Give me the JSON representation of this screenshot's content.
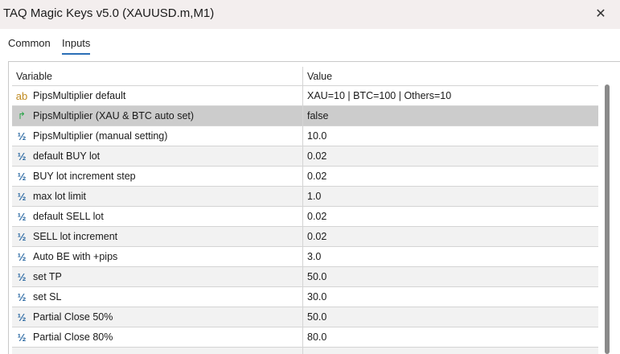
{
  "window": {
    "title": "TAQ Magic Keys v5.0 (XAUUSD.m,M1)",
    "close_glyph": "✕"
  },
  "tabs": [
    {
      "label": "Common",
      "active": false
    },
    {
      "label": "Inputs",
      "active": true
    }
  ],
  "table": {
    "headers": {
      "variable": "Variable",
      "value": "Value"
    },
    "rows": [
      {
        "icon": "ab",
        "icon_name": "string-type-icon",
        "variable": "PipsMultiplier default",
        "value": "XAU=10 | BTC=100 | Others=10"
      },
      {
        "icon": "↱",
        "icon_name": "bool-type-icon",
        "variable": "PipsMultiplier (XAU & BTC auto set)",
        "value": "false"
      },
      {
        "icon": "½",
        "icon_name": "double-type-icon",
        "variable": "PipsMultiplier (manual setting)",
        "value": "10.0"
      },
      {
        "icon": "½",
        "icon_name": "double-type-icon",
        "variable": "default BUY lot",
        "value": "0.02"
      },
      {
        "icon": "½",
        "icon_name": "double-type-icon",
        "variable": "BUY lot increment step",
        "value": "0.02"
      },
      {
        "icon": "½",
        "icon_name": "double-type-icon",
        "variable": "max lot limit",
        "value": "1.0"
      },
      {
        "icon": "½",
        "icon_name": "double-type-icon",
        "variable": "default SELL lot",
        "value": "0.02"
      },
      {
        "icon": "½",
        "icon_name": "double-type-icon",
        "variable": "SELL lot increment",
        "value": "0.02"
      },
      {
        "icon": "½",
        "icon_name": "double-type-icon",
        "variable": "Auto BE with +pips",
        "value": "3.0"
      },
      {
        "icon": "½",
        "icon_name": "double-type-icon",
        "variable": "set TP",
        "value": "50.0"
      },
      {
        "icon": "½",
        "icon_name": "double-type-icon",
        "variable": "set SL",
        "value": "30.0"
      },
      {
        "icon": "½",
        "icon_name": "double-type-icon",
        "variable": "Partial Close 50%",
        "value": "50.0"
      },
      {
        "icon": "½",
        "icon_name": "double-type-icon",
        "variable": "Partial Close 80%",
        "value": "80.0"
      },
      {
        "icon": "½",
        "icon_name": "double-type-icon",
        "variable": "",
        "value": ""
      }
    ]
  },
  "colors": {
    "titlebar_bg": "#f3eeee",
    "tab_underline": "#2b6fb6",
    "row_alt": "#f2f2f2",
    "row_selected": "#cccccc"
  }
}
